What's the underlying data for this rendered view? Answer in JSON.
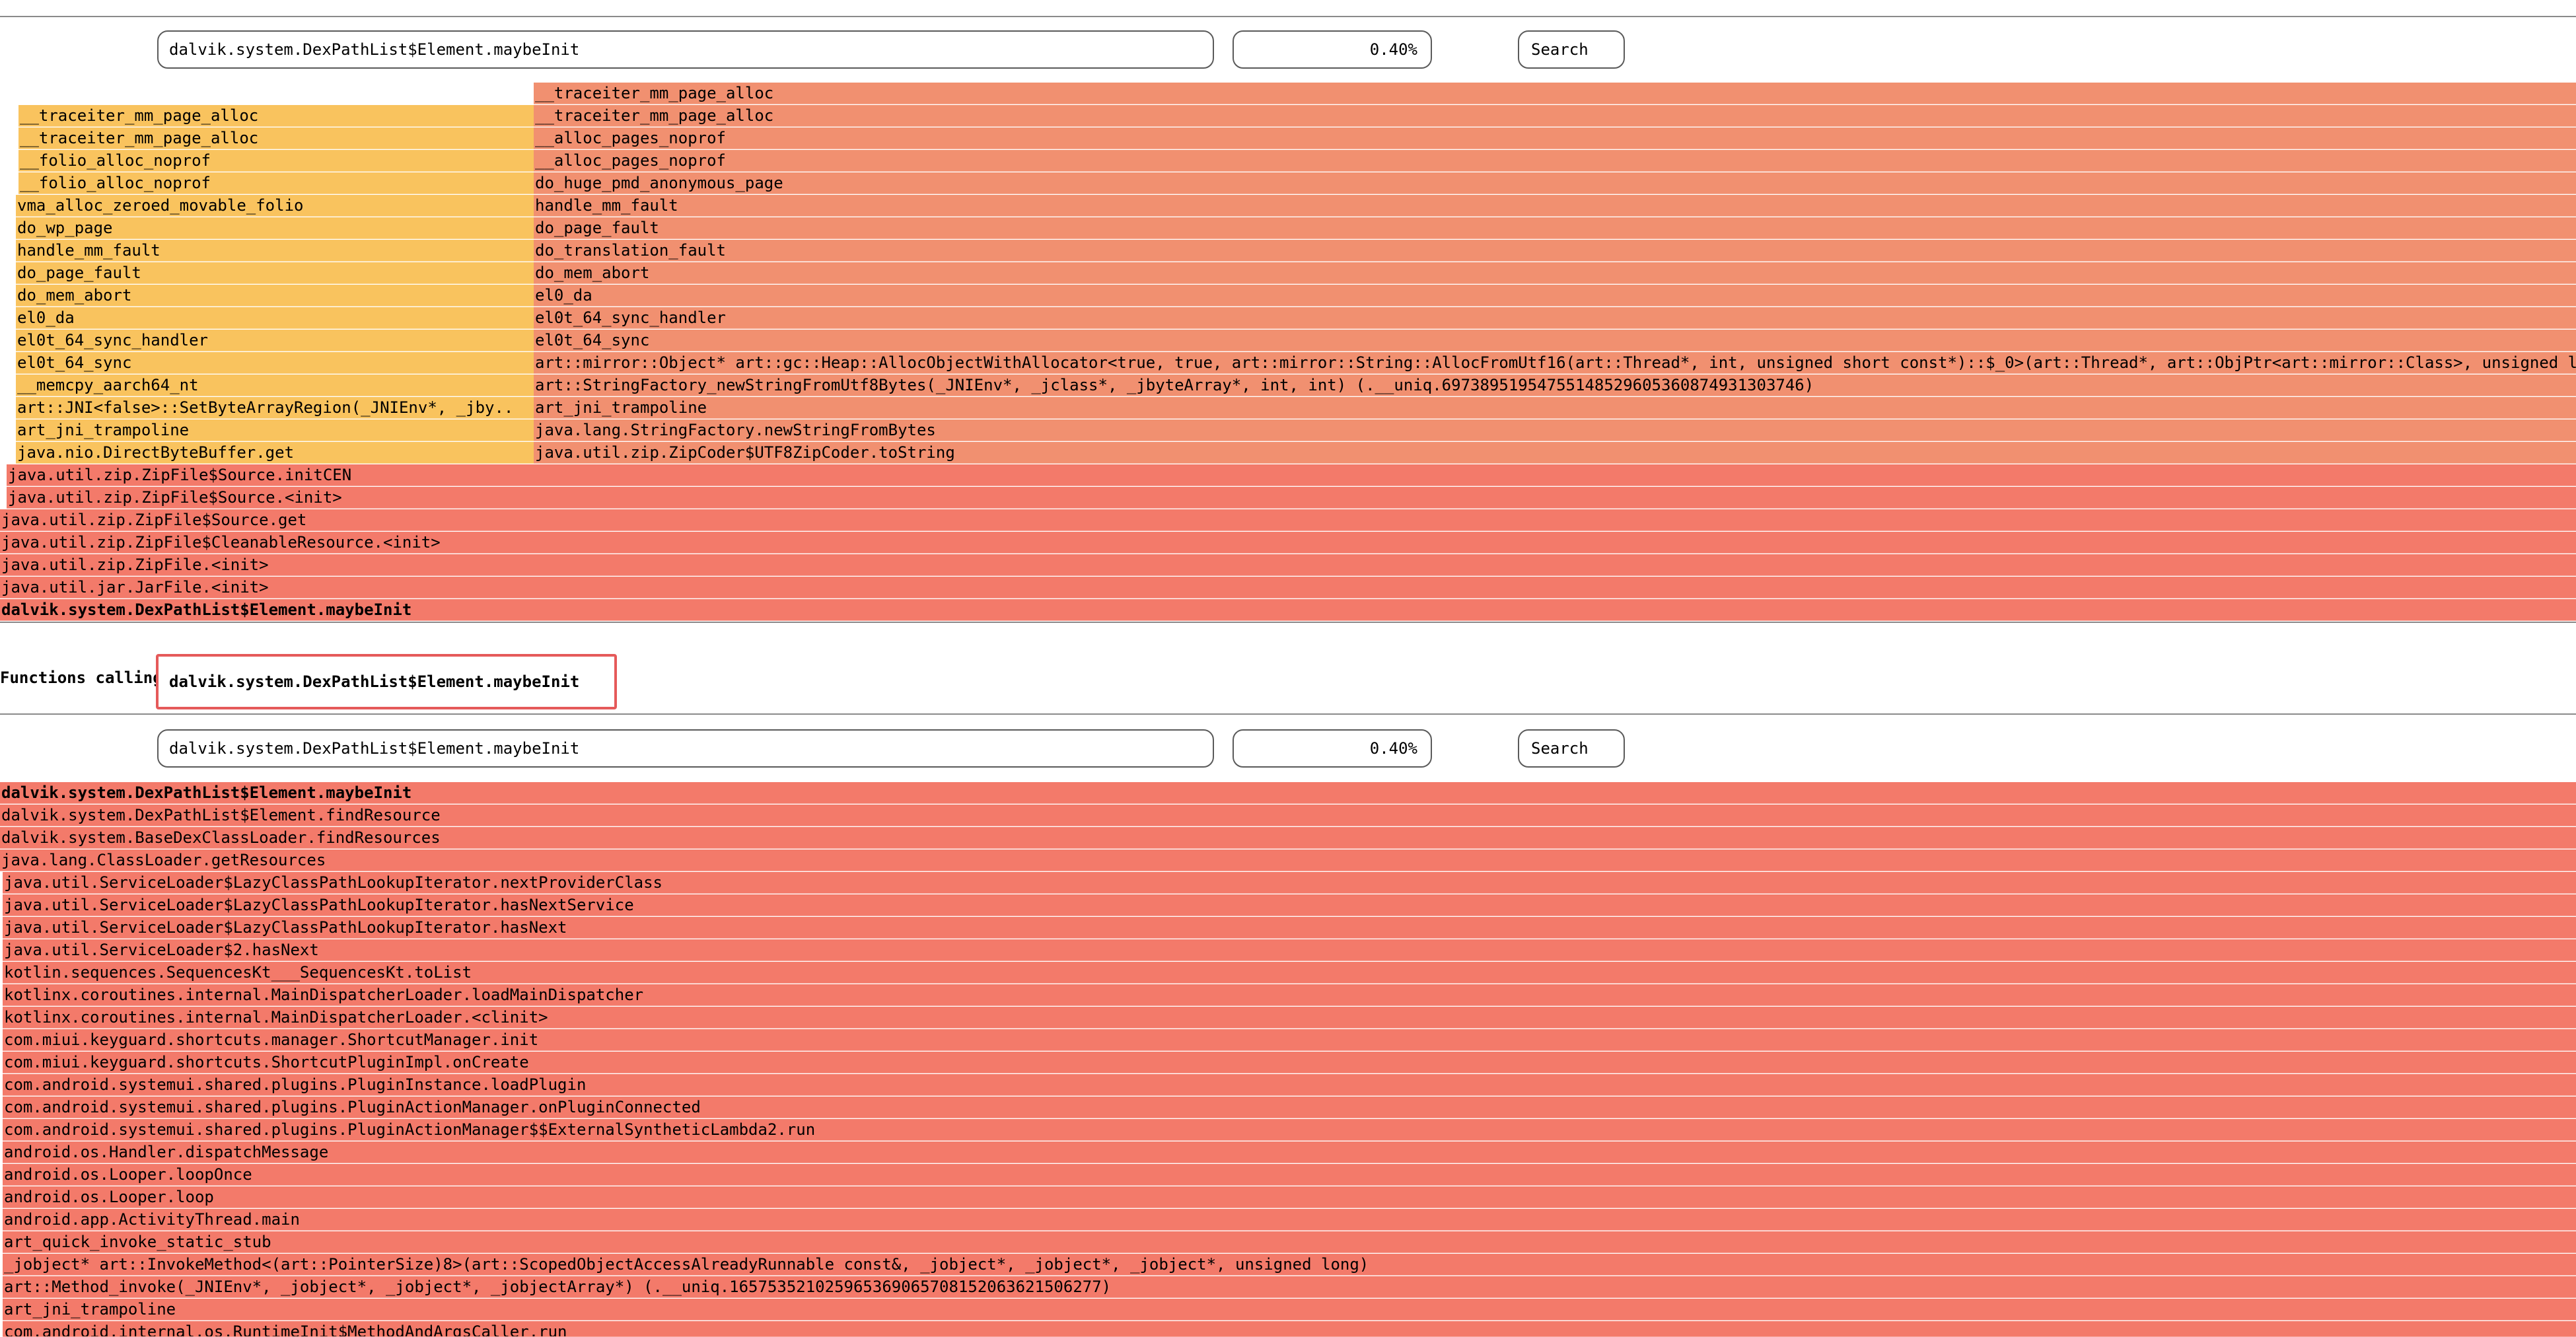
{
  "top_panel": {
    "search_value": "dalvik.system.DexPathList$Element.maybeInit",
    "percent_value": "0.40%",
    "search_label": "Search"
  },
  "bottom_panel": {
    "callers_label": "Functions calling",
    "callers_function": "dalvik.system.DexPathList$Element.maybeInit",
    "search_value": "dalvik.system.DexPathList$Element.maybeInit",
    "percent_value": "0.40%",
    "search_label": "Search"
  },
  "top_flame": [
    "__traceiter_mm_page_alloc",
    "__traceiter_mm_page_alloc",
    "__traceiter_mm_page_alloc",
    "__traceiter_mm_page_alloc",
    "__alloc_pages_noprof",
    "__folio_alloc_noprof",
    "__alloc_pages_noprof",
    "__folio_alloc_noprof",
    "do_huge_pmd_anonymous_page",
    "vma_alloc_zeroed_movable_folio",
    "handle_mm_fault",
    "do_wp_page",
    "do_page_fault",
    "handle_mm_fault",
    "do_translation_fault",
    "do_page_fault",
    "do_mem_abort",
    "do_mem_abort",
    "el0_da",
    "el0_da",
    "el0t_64_sync_handler",
    "el0t_64_sync_handler",
    "el0t_64_sync",
    "el0t_64_sync",
    "art::mirror::Object* art::gc::Heap::AllocObjectWithAllocator<true, true, art::mirror::String::AllocFromUtf16(art::Thread*, int, unsigned short const*)::$_0>(art::Thread*, art::ObjPtr<art::mirror::Class>, unsigned l",
    "__memcpy_aarch64_nt",
    "art::StringFactory_newStringFromUtf8Bytes(_JNIEnv*, _jclass*, _jbyteArray*, int, int) (.__uniq.69738951954755148529605360874931303746)",
    "art::JNI<false>::SetByteArrayRegion(_JNIEnv*, _jby..",
    "art_jni_trampoline",
    "art_jni_trampoline",
    "java.lang.StringFactory.newStringFromBytes",
    "java.nio.DirectByteBuffer.get",
    "java.util.zip.ZipCoder$UTF8ZipCoder.toString",
    "java.util.zip.ZipFile$Source.initCEN",
    "java.util.zip.ZipFile$Source.<init>",
    "java.util.zip.ZipFile$Source.get",
    "java.util.zip.ZipFile$CleanableResource.<init>",
    "java.util.zip.ZipFile.<init>",
    "java.util.jar.JarFile.<init>",
    "dalvik.system.DexPathList$Element.maybeInit"
  ],
  "bottom_flame": [
    "dalvik.system.DexPathList$Element.maybeInit",
    "dalvik.system.DexPathList$Element.findResource",
    "dalvik.system.BaseDexClassLoader.findResources",
    "java.lang.ClassLoader.getResources",
    "java.util.ServiceLoader$LazyClassPathLookupIterator.nextProviderClass",
    "java.util.ServiceLoader$LazyClassPathLookupIterator.hasNextService",
    "java.util.ServiceLoader$LazyClassPathLookupIterator.hasNext",
    "java.util.ServiceLoader$2.hasNext",
    "kotlin.sequences.SequencesKt___SequencesKt.toList",
    "kotlinx.coroutines.internal.MainDispatcherLoader.loadMainDispatcher",
    "kotlinx.coroutines.internal.MainDispatcherLoader.<clinit>",
    "com.miui.keyguard.shortcuts.manager.ShortcutManager.init",
    "com.miui.keyguard.shortcuts.ShortcutPluginImpl.onCreate",
    "com.android.systemui.shared.plugins.PluginInstance.loadPlugin",
    "com.android.systemui.shared.plugins.PluginActionManager.onPluginConnected",
    "com.android.systemui.shared.plugins.PluginActionManager$$ExternalSyntheticLambda2.run",
    "android.os.Handler.dispatchMessage",
    "android.os.Looper.loopOnce",
    "android.os.Looper.loop",
    "android.app.ActivityThread.main",
    "art_quick_invoke_static_stub",
    "_jobject* art::InvokeMethod<(art::PointerSize)8>(art::ScopedObjectAccessAlreadyRunnable const&, _jobject*, _jobject*, _jobject*, unsigned long)",
    "art::Method_invoke(_JNIEnv*, _jobject*, _jobject*, _jobjectArray*) (.__uniq.165753521025965369065708152063621506277)",
    "art_jni_trampoline",
    "com.android.internal.os.RuntimeInit$MethodAndArgsCaller.run"
  ]
}
